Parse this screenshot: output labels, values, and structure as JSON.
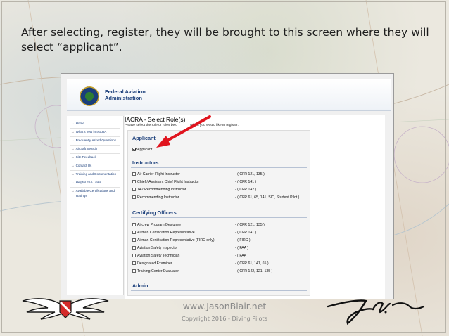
{
  "slide": {
    "headline": "After selecting, register, they will be brought to this screen where they will select “applicant”.",
    "footer_site": "www.JasonBlair.net",
    "footer_copyright": "Copyright 2016 - Diving Pilots",
    "logo_icon": "diving-pilots-wings-logo",
    "signature_icon": "handwritten-signature"
  },
  "faa": {
    "name_line1": "Federal Aviation",
    "name_line2": "Administration"
  },
  "sidebar": {
    "items": [
      {
        "label": "Home"
      },
      {
        "label": "What's new in IACRA"
      },
      {
        "label": "Frequently Asked Questions"
      },
      {
        "label": "Aircraft Search"
      },
      {
        "label": "Site Feedback"
      },
      {
        "label": "Contact Us"
      },
      {
        "label": "Training and Documentation"
      },
      {
        "label": "Helpful FAA Links"
      },
      {
        "label": "Available Certifications and"
      },
      {
        "label": "Ratings"
      }
    ]
  },
  "page": {
    "title": "IACRA - Select Role(s)",
    "subtitle_part1": "Please select the role or roles belo",
    "subtitle_part2": "which you would like to register."
  },
  "sections": {
    "applicant": {
      "title": "Applicant",
      "roles": [
        {
          "label": "Applicant",
          "checked": true
        }
      ]
    },
    "instructors": {
      "title": "Instructors",
      "roles": [
        {
          "label": "Air Carrier Flight Instructor",
          "cfr": "-   ( CFR 121, 135 )"
        },
        {
          "label": "Chief / Assistant Chief Flight Instructor",
          "cfr": "-   ( CFR 141 )"
        },
        {
          "label": "142 Recommending Instructor",
          "cfr": "-   ( CFR 142 )"
        },
        {
          "label": "Recommending Instructor",
          "cfr": "-   ( CFR 61, 65, 141, SIC, Student Pilot )"
        }
      ]
    },
    "certifying": {
      "title": "Certifying Officers",
      "roles": [
        {
          "label": "Aircrew Program Designee",
          "cfr": "-   ( CFR 121, 135 )"
        },
        {
          "label": "Airman Certification Representative",
          "cfr": "-   ( CFR 141 )"
        },
        {
          "label": "Airman Certification Representative (FIRC only)",
          "cfr": "-   ( FIRC )"
        },
        {
          "label": "Aviation Safety Inspector",
          "cfr": "-   ( FAA )"
        },
        {
          "label": "Aviation Safety Technician",
          "cfr": "-   ( FAA )"
        },
        {
          "label": "Designated Examiner",
          "cfr": "-   ( CFR 61, 141, 65 )"
        },
        {
          "label": "Training Center Evaluator",
          "cfr": "-   ( CFR 142, 121, 135 )"
        }
      ]
    },
    "admin": {
      "title": "Admin"
    }
  },
  "colors": {
    "faa_blue": "#1a3e7a",
    "annotation_red": "#e0141e"
  }
}
